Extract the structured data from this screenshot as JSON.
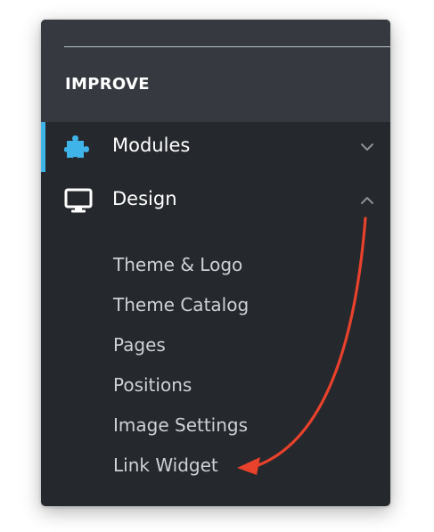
{
  "section": {
    "title": "IMPROVE"
  },
  "nav": {
    "modules": {
      "label": "Modules",
      "icon": "puzzle-icon",
      "chevron": "chevron-down-icon",
      "active": true
    },
    "design": {
      "label": "Design",
      "icon": "monitor-icon",
      "chevron": "chevron-up-icon",
      "expanded": true
    }
  },
  "submenu": [
    "Theme & Logo",
    "Theme Catalog",
    "Pages",
    "Positions",
    "Image Settings",
    "Link Widget"
  ],
  "colors": {
    "panel_bg": "#25282c",
    "header_bg": "#363a40",
    "active_accent": "#3fb4e8",
    "icon_blue": "#3fb4e8",
    "arrow": "#e8412c"
  }
}
